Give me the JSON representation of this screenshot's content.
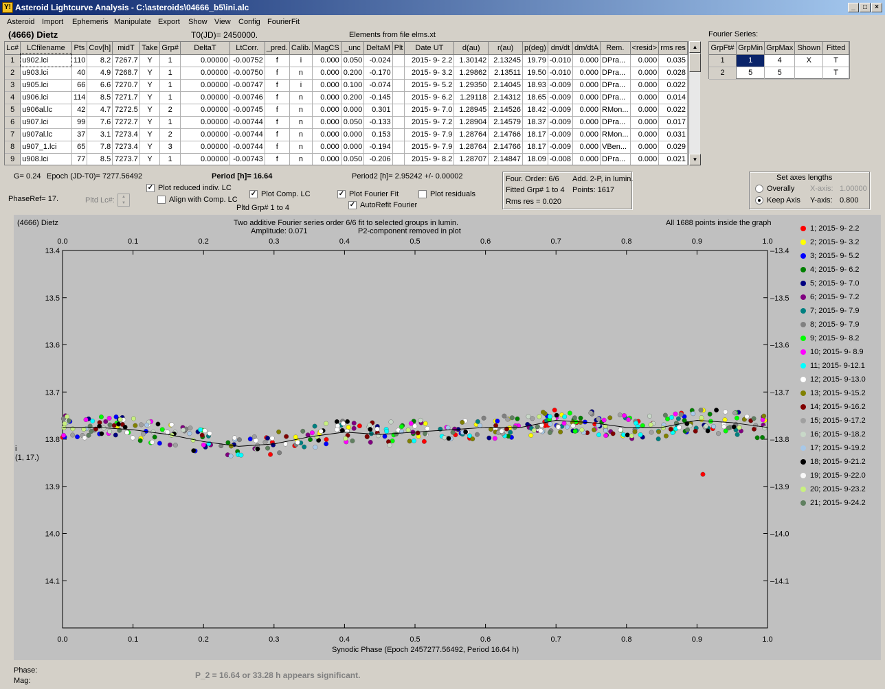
{
  "window": {
    "title": "Asteroid Lightcurve Analysis - C:\\asteroids\\04666_b5\\ini.alc",
    "app_icon": "Y!",
    "min": "_",
    "max": "□",
    "close": "×"
  },
  "menu": [
    "Asteroid",
    "Import",
    "Ephemeris",
    "Manipulate",
    "Export",
    "Show",
    "View",
    "Config",
    "FourierFit"
  ],
  "header": {
    "asteroid": "(4666) Dietz",
    "t0": "T0(JD)= 2450000.",
    "elements": "Elements from file elms.xt",
    "fourier_series": "Fourier Series:"
  },
  "lc_table": {
    "columns": [
      "Lc#",
      "LCfilename",
      "Pts",
      "Cov[h]",
      "midT",
      "Take",
      "Grp#",
      "DeltaT",
      "LtCorr.",
      "_pred.",
      "Calib.",
      "MagCS",
      "_unc",
      "DeltaM",
      "Plt",
      "Date UT",
      "d(au)",
      "r(au)",
      "p(deg)",
      "dm/dt",
      "dm/dtA",
      "Rem.",
      "<resid>",
      "rms res"
    ],
    "rows": [
      [
        "1",
        "u902.lci",
        "110",
        "8.2",
        "7267.7",
        "Y",
        "1",
        "0.00000",
        "-0.00752",
        "f",
        "i",
        "0.000",
        "0.050",
        "-0.024",
        "",
        "2015- 9- 2.2",
        "1.30142",
        "2.13245",
        "19.79",
        "-0.010",
        "0.000",
        "DPra...",
        "0.000",
        "0.035"
      ],
      [
        "2",
        "u903.lci",
        "40",
        "4.9",
        "7268.7",
        "Y",
        "1",
        "0.00000",
        "-0.00750",
        "f",
        "n",
        "0.000",
        "0.200",
        "-0.170",
        "",
        "2015- 9- 3.2",
        "1.29862",
        "2.13511",
        "19.50",
        "-0.010",
        "0.000",
        "DPra...",
        "0.000",
        "0.028"
      ],
      [
        "3",
        "u905.lci",
        "66",
        "6.6",
        "7270.7",
        "Y",
        "1",
        "0.00000",
        "-0.00747",
        "f",
        "i",
        "0.000",
        "0.100",
        "-0.074",
        "",
        "2015- 9- 5.2",
        "1.29350",
        "2.14045",
        "18.93",
        "-0.009",
        "0.000",
        "DPra...",
        "0.000",
        "0.022"
      ],
      [
        "4",
        "u906.lci",
        "114",
        "8.5",
        "7271.7",
        "Y",
        "1",
        "0.00000",
        "-0.00746",
        "f",
        "n",
        "0.000",
        "0.200",
        "-0.145",
        "",
        "2015- 9- 6.2",
        "1.29118",
        "2.14312",
        "18.65",
        "-0.009",
        "0.000",
        "DPra...",
        "0.000",
        "0.014"
      ],
      [
        "5",
        "u906al.lc",
        "42",
        "4.7",
        "7272.5",
        "Y",
        "2",
        "0.00000",
        "-0.00745",
        "f",
        "n",
        "0.000",
        "0.000",
        "0.301",
        "",
        "2015- 9- 7.0",
        "1.28945",
        "2.14526",
        "18.42",
        "-0.009",
        "0.000",
        "RMon...",
        "0.000",
        "0.022"
      ],
      [
        "6",
        "u907.lci",
        "99",
        "7.6",
        "7272.7",
        "Y",
        "1",
        "0.00000",
        "-0.00744",
        "f",
        "n",
        "0.000",
        "0.050",
        "-0.133",
        "",
        "2015- 9- 7.2",
        "1.28904",
        "2.14579",
        "18.37",
        "-0.009",
        "0.000",
        "DPra...",
        "0.000",
        "0.017"
      ],
      [
        "7",
        "u907al.lc",
        "37",
        "3.1",
        "7273.4",
        "Y",
        "2",
        "0.00000",
        "-0.00744",
        "f",
        "n",
        "0.000",
        "0.000",
        "0.153",
        "",
        "2015- 9- 7.9",
        "1.28764",
        "2.14766",
        "18.17",
        "-0.009",
        "0.000",
        "RMon...",
        "0.000",
        "0.031"
      ],
      [
        "8",
        "u907_1.lci",
        "65",
        "7.8",
        "7273.4",
        "Y",
        "3",
        "0.00000",
        "-0.00744",
        "f",
        "n",
        "0.000",
        "0.000",
        "-0.194",
        "",
        "2015- 9- 7.9",
        "1.28764",
        "2.14766",
        "18.17",
        "-0.009",
        "0.000",
        "VBen...",
        "0.000",
        "0.029"
      ],
      [
        "9",
        "u908.lci",
        "77",
        "8.5",
        "7273.7",
        "Y",
        "1",
        "0.00000",
        "-0.00743",
        "f",
        "n",
        "0.000",
        "0.050",
        "-0.206",
        "",
        "2015- 9- 8.2",
        "1.28707",
        "2.14847",
        "18.09",
        "-0.008",
        "0.000",
        "DPra...",
        "0.000",
        "0.021"
      ]
    ]
  },
  "fourier_table": {
    "columns": [
      "GrpFt#",
      "GrpMin",
      "GrpMax",
      "Shown",
      "Fitted"
    ],
    "rows": [
      [
        "1",
        "1",
        "4",
        "X",
        "T"
      ],
      [
        "2",
        "5",
        "5",
        "",
        "T"
      ]
    ]
  },
  "info": {
    "g": "G= 0.24",
    "epoch": "Epoch (JD-T0)= 7277.56492",
    "period": "Period [h]= 16.64",
    "period2": "Period2 [h]= 2.95242 +/- 0.00002",
    "phaseref": "PhaseRef= 17.",
    "pltd_lc": "Pltd Lc#:",
    "pltd_grp": "Pltd Grp#  1   to   4"
  },
  "checks": {
    "plot_reduced": {
      "label": "Plot reduced indiv. LC",
      "checked": true
    },
    "align_comp": {
      "label": "Align with Comp. LC",
      "checked": false
    },
    "plot_comp": {
      "label": "Plot Comp. LC",
      "checked": true
    },
    "plot_fourier": {
      "label": "Plot Fourier Fit",
      "checked": true
    },
    "autorefit": {
      "label": "AutoRefit Fourier",
      "checked": true
    },
    "plot_resid": {
      "label": "Plot residuals",
      "checked": false
    }
  },
  "fit_box": {
    "order": "Four. Order:  6/6",
    "add": "Add. 2-P, in lumin.",
    "fitted": "Fitted Grp# 1 to 4",
    "points": "Points: 1617",
    "rms": "Rms res     = 0.020"
  },
  "axes_box": {
    "title": "Set axes lengths",
    "overally": "Overally",
    "keep": "Keep Axis",
    "x_label": "X-axis:",
    "x_val": "1.00000",
    "y_label": "Y-axis:",
    "y_val": "0.800",
    "selected": "Keep Axis"
  },
  "plot": {
    "name": "(4666) Dietz",
    "title1": "Two additive Fourier series order 6/6 fit to selected groups in lumin.",
    "title2": "Amplitude: 0.071",
    "title3": "P2-component removed in plot",
    "note": "All 1688 points inside the graph",
    "ylabel1": "i",
    "ylabel2": "(1, 17.)",
    "xlabel": "Synodic Phase (Epoch 2457277.56492, Period 16.64 h)",
    "colors": {
      "bg": "#c0c0c0",
      "fit": "#000000"
    }
  },
  "chart_data": {
    "type": "scatter",
    "xlabel": "Synodic Phase (Epoch 2457277.56492, Period 16.64 h)",
    "ylabel": "i (1, 17.)",
    "xlim": [
      0.0,
      1.0
    ],
    "ylim": [
      13.4,
      14.2
    ],
    "y_inverted": true,
    "x_ticks": [
      "0.0",
      "0.1",
      "0.2",
      "0.3",
      "0.4",
      "0.5",
      "0.6",
      "0.7",
      "0.8",
      "0.9",
      "1.0"
    ],
    "y_ticks": [
      "13.4",
      "13.5",
      "13.6",
      "13.7",
      "13.8",
      "13.9",
      "14.0",
      "14.1"
    ],
    "fourier_fit": {
      "x": [
        0.0,
        0.05,
        0.1,
        0.15,
        0.2,
        0.25,
        0.3,
        0.35,
        0.4,
        0.45,
        0.5,
        0.55,
        0.6,
        0.65,
        0.7,
        0.75,
        0.8,
        0.85,
        0.9,
        0.95,
        1.0
      ],
      "y": [
        13.775,
        13.775,
        13.78,
        13.79,
        13.805,
        13.815,
        13.81,
        13.795,
        13.785,
        13.79,
        13.785,
        13.78,
        13.775,
        13.775,
        13.76,
        13.765,
        13.775,
        13.775,
        13.76,
        13.765,
        13.775
      ]
    },
    "series": [
      {
        "name": "1; 2015- 9- 2.2",
        "color": "#ff0000"
      },
      {
        "name": "2; 2015- 9- 3.2",
        "color": "#ffff00"
      },
      {
        "name": "3; 2015- 9- 5.2",
        "color": "#0000ff"
      },
      {
        "name": "4; 2015- 9- 6.2",
        "color": "#008000"
      },
      {
        "name": "5; 2015- 9- 7.0",
        "color": "#000080"
      },
      {
        "name": "6; 2015- 9- 7.2",
        "color": "#800080"
      },
      {
        "name": "7; 2015- 9- 7.9",
        "color": "#008080"
      },
      {
        "name": "8; 2015- 9- 7.9",
        "color": "#808080"
      },
      {
        "name": "9; 2015- 9- 8.2",
        "color": "#00ff00"
      },
      {
        "name": "10; 2015- 9- 8.9",
        "color": "#ff00ff"
      },
      {
        "name": "11; 2015- 9-12.1",
        "color": "#00ffff"
      },
      {
        "name": "12; 2015- 9-13.0",
        "color": "#ffffff"
      },
      {
        "name": "13; 2015- 9-15.2",
        "color": "#808000"
      },
      {
        "name": "14; 2015- 9-16.2",
        "color": "#800000"
      },
      {
        "name": "15; 2015- 9-17.2",
        "color": "#a0a0a0"
      },
      {
        "name": "16; 2015- 9-18.2",
        "color": "#c8d8c8"
      },
      {
        "name": "17; 2015- 9-19.2",
        "color": "#a8c8e8"
      },
      {
        "name": "18; 2015- 9-21.2",
        "color": "#000000"
      },
      {
        "name": "19; 2015- 9-22.0",
        "color": "#f8f8f8"
      },
      {
        "name": "20; 2015- 9-23.2",
        "color": "#c8f080"
      },
      {
        "name": "21; 2015- 9-24.2",
        "color": "#608060"
      }
    ]
  },
  "status": {
    "phase": "Phase:",
    "mag": "Mag:",
    "message": "P_2 = 16.64 or 33.28 h appears significant."
  }
}
